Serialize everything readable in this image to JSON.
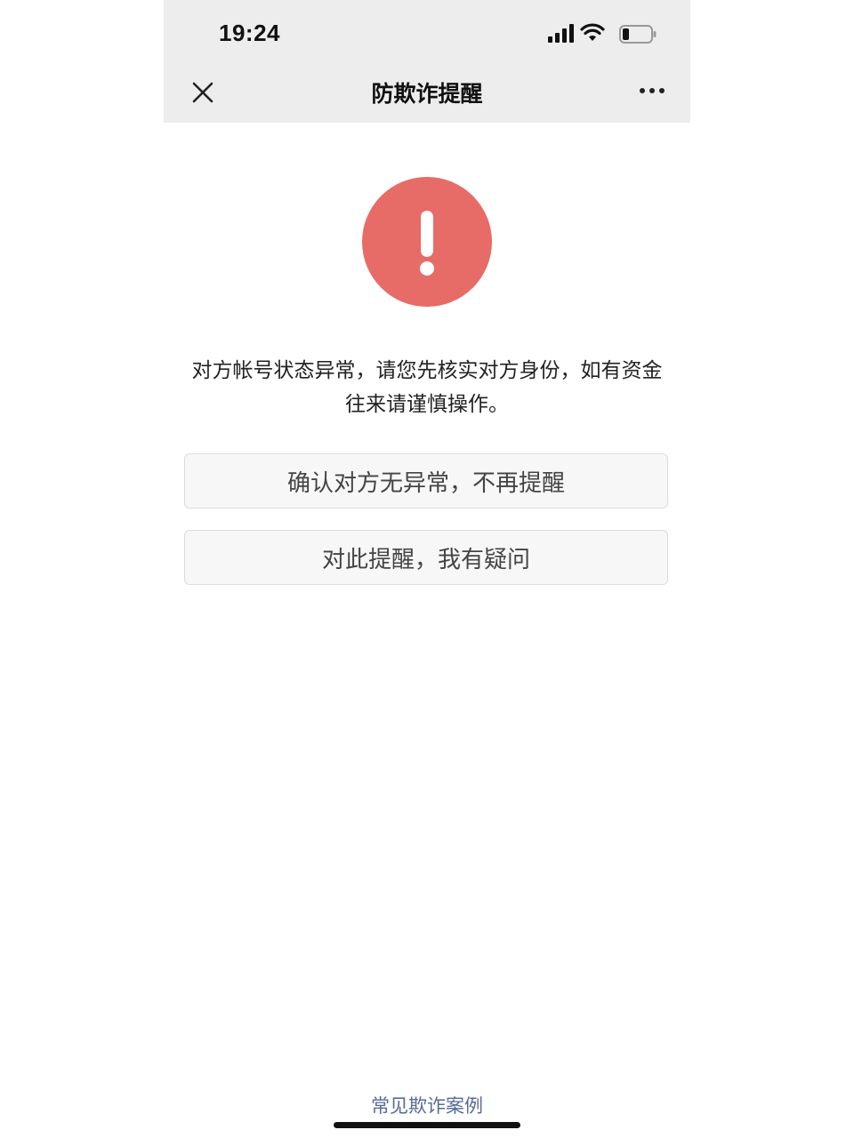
{
  "status_bar": {
    "time": "19:24"
  },
  "nav": {
    "title": "防欺诈提醒",
    "close_icon": "close-icon",
    "more_icon": "more-dots-icon"
  },
  "alert": {
    "icon": "exclamation-icon",
    "color": "#e76b66",
    "message": "对方帐号状态异常，请您先核实对方身份，如有资金往来请谨慎操作。"
  },
  "buttons": {
    "confirm_label": "确认对方无异常，不再提醒",
    "question_label": "对此提醒，我有疑问"
  },
  "footer": {
    "link_label": "常见欺诈案例",
    "link_color": "#576b95"
  }
}
